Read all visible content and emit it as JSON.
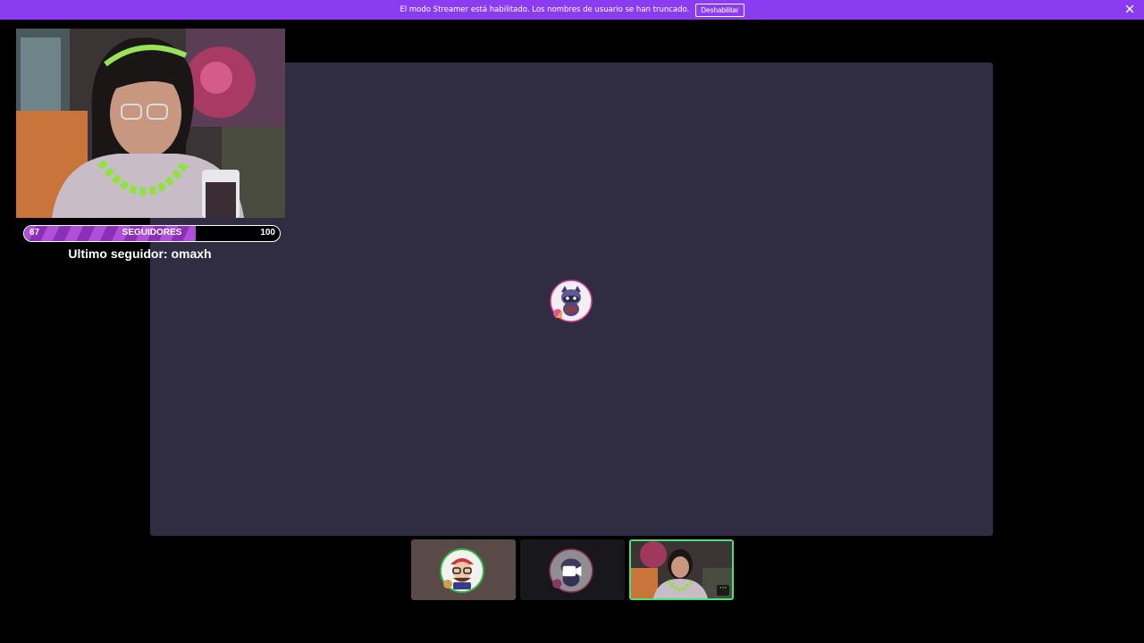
{
  "banner": {
    "message": "El modo Streamer está habilitado. Los nombres de usuario se han truncado.",
    "button_label": "Deshabilitar",
    "background_color": "#8c3cf0"
  },
  "icons": {
    "close": "close-icon",
    "more": "more-options-icon",
    "camera": "camera-icon"
  },
  "overlay": {
    "followers_goal": {
      "current": "67",
      "label": "SEGUIDORES",
      "target": "100",
      "progress": 0.67
    },
    "last_follower_text": "Ultimo seguidor: omaxh"
  },
  "stage": {
    "background_color": "#302d43"
  },
  "participants": {
    "tile_1_background": "#5a4a47",
    "tile_2_background": "#18171c",
    "active_border_color": "#48e27a",
    "more_glyph": "···"
  }
}
